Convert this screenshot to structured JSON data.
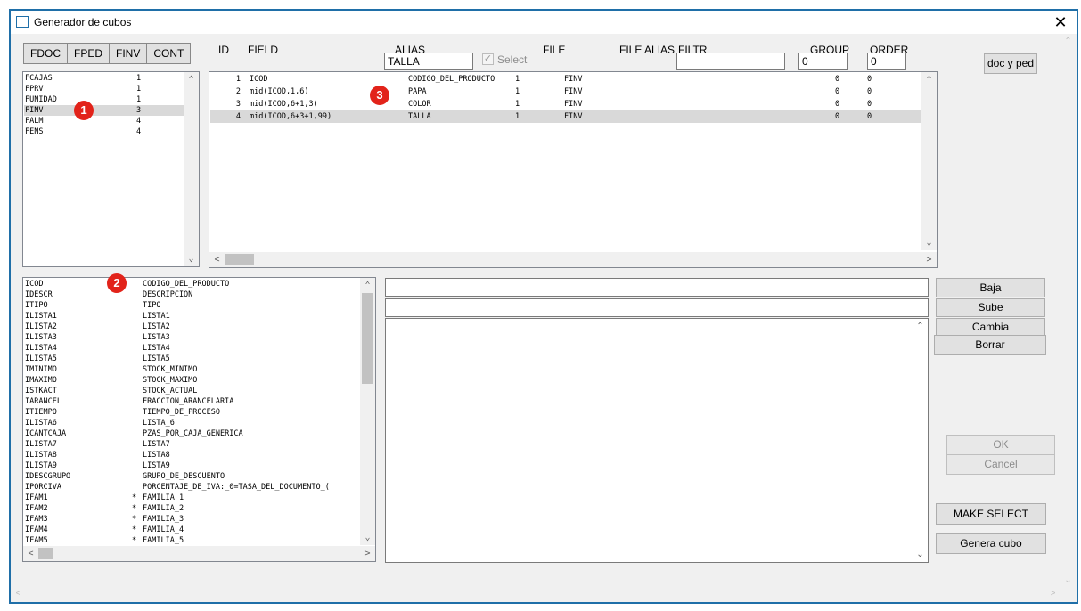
{
  "window": {
    "title": "Generador de cubos",
    "close": "✕"
  },
  "tabs": [
    "FDOC",
    "FPED",
    "FINV",
    "CONT"
  ],
  "headers": {
    "id": "ID",
    "field": "FIELD",
    "alias": "ALIAS",
    "select": "Select",
    "file": "FILE",
    "file_alias": "FILE ALIAS",
    "filtr": "FILTR",
    "group": "GROUP",
    "order": "ORDER"
  },
  "inputs": {
    "alias_value": "TALLA",
    "filtr_value": "",
    "group_value": "0",
    "order_value": "0"
  },
  "badges": {
    "b1": "1",
    "b2": "2",
    "b3": "3"
  },
  "files_list": [
    {
      "name": "FCAJAS",
      "count": "1"
    },
    {
      "name": "FPRV",
      "count": "1"
    },
    {
      "name": "FUNIDAD",
      "count": "1"
    },
    {
      "name": "FINV",
      "count": "3"
    },
    {
      "name": "FALM",
      "count": "4"
    },
    {
      "name": "FENS",
      "count": "4"
    }
  ],
  "select_rows": [
    {
      "id": "1",
      "field": "ICOD",
      "alias": "CODIGO_DEL_PRODUCTO",
      "select": "1",
      "file": "FINV",
      "group": "0",
      "order": "0"
    },
    {
      "id": "2",
      "field": "mid(ICOD,1,6)",
      "alias": "PAPA",
      "select": "1",
      "file": "FINV",
      "group": "0",
      "order": "0"
    },
    {
      "id": "3",
      "field": "mid(ICOD,6+1,3)",
      "alias": "COLOR",
      "select": "1",
      "file": "FINV",
      "group": "0",
      "order": "0"
    },
    {
      "id": "4",
      "field": "mid(ICOD,6+3+1,99)",
      "alias": "TALLA",
      "select": "1",
      "file": "FINV",
      "group": "0",
      "order": "0"
    }
  ],
  "fields_list": [
    {
      "name": "ICOD",
      "mark": "",
      "desc": "CODIGO_DEL_PRODUCTO"
    },
    {
      "name": "IDESCR",
      "mark": "",
      "desc": "DESCRIPCION"
    },
    {
      "name": "ITIPO",
      "mark": "",
      "desc": "TIPO"
    },
    {
      "name": "ILISTA1",
      "mark": "",
      "desc": "LISTA1"
    },
    {
      "name": "ILISTA2",
      "mark": "",
      "desc": "LISTA2"
    },
    {
      "name": "ILISTA3",
      "mark": "",
      "desc": "LISTA3"
    },
    {
      "name": "ILISTA4",
      "mark": "",
      "desc": "LISTA4"
    },
    {
      "name": "ILISTA5",
      "mark": "",
      "desc": "LISTA5"
    },
    {
      "name": "IMINIMO",
      "mark": "",
      "desc": "STOCK_MINIMO"
    },
    {
      "name": "IMAXIMO",
      "mark": "",
      "desc": "STOCK_MAXIMO"
    },
    {
      "name": "ISTKACT",
      "mark": "",
      "desc": "STOCK_ACTUAL"
    },
    {
      "name": "IARANCEL",
      "mark": "",
      "desc": "FRACCION_ARANCELARIA"
    },
    {
      "name": "ITIEMPO",
      "mark": "",
      "desc": "TIEMPO_DE_PROCESO"
    },
    {
      "name": "ILISTA6",
      "mark": "",
      "desc": "LISTA_6"
    },
    {
      "name": "ICANTCAJA",
      "mark": "",
      "desc": "PZAS_POR_CAJA_GENERICA"
    },
    {
      "name": "ILISTA7",
      "mark": "",
      "desc": "LISTA7"
    },
    {
      "name": "ILISTA8",
      "mark": "",
      "desc": "LISTA8"
    },
    {
      "name": "ILISTA9",
      "mark": "",
      "desc": "LISTA9"
    },
    {
      "name": "IDESCGRUPO",
      "mark": "",
      "desc": "GRUPO_DE_DESCUENTO"
    },
    {
      "name": "IPORCIVA",
      "mark": "",
      "desc": "PORCENTAJE_DE_IVA:_0=TASA_DEL_DOCUMENTO_("
    },
    {
      "name": "IFAM1",
      "mark": "*",
      "desc": "FAMILIA_1"
    },
    {
      "name": "IFAM2",
      "mark": "*",
      "desc": "FAMILIA_2"
    },
    {
      "name": "IFAM3",
      "mark": "*",
      "desc": "FAMILIA_3"
    },
    {
      "name": "IFAM4",
      "mark": "*",
      "desc": "FAMILIA_4"
    },
    {
      "name": "IFAM5",
      "mark": "*",
      "desc": "FAMILIA_5"
    }
  ],
  "buttons": {
    "doc_ped": "doc y ped",
    "baja": "Baja",
    "sube": "Sube",
    "cambia": "Cambia",
    "borrar": "Borrar",
    "ok": "OK",
    "cancel": "Cancel",
    "make_select": "MAKE SELECT",
    "genera_cubo": "Genera cubo"
  },
  "scroll_glyphs": {
    "up": "⌃",
    "down": "⌄",
    "left": "<",
    "right": ">"
  }
}
